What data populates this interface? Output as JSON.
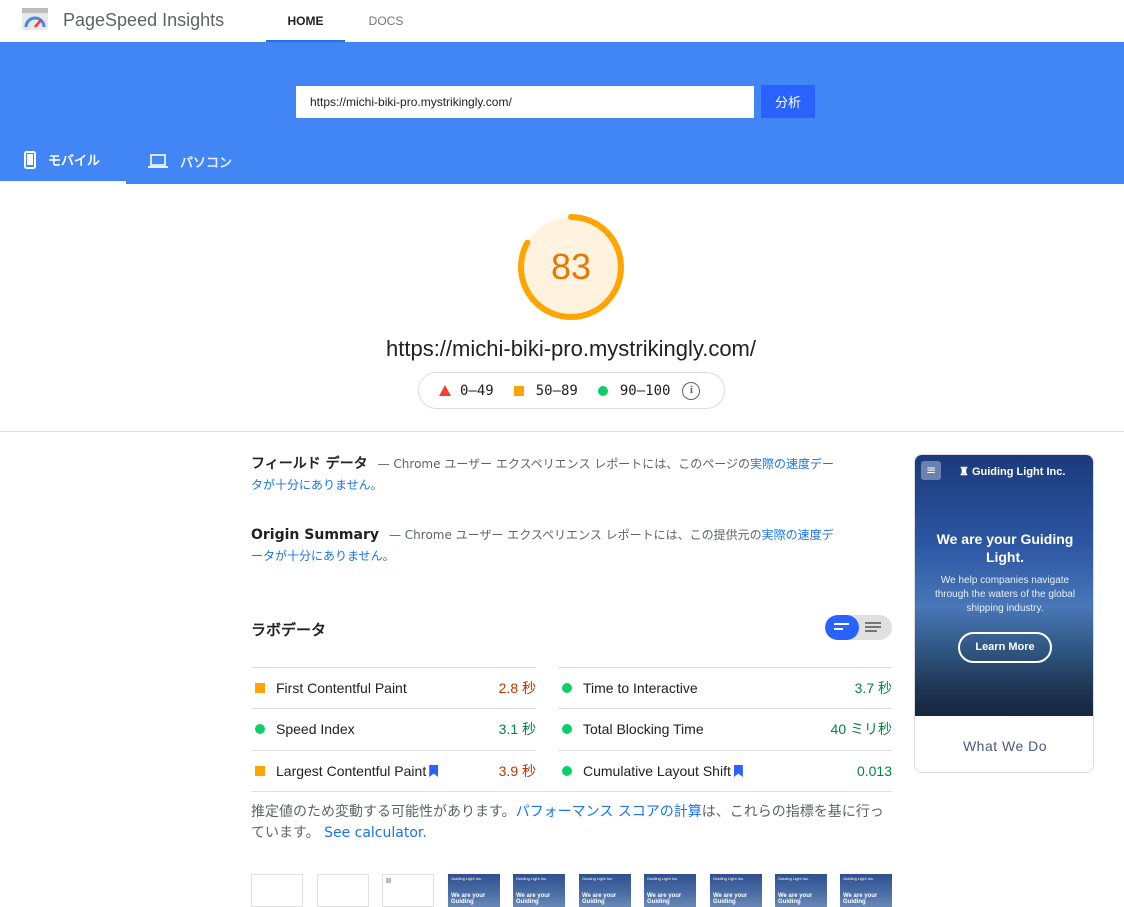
{
  "header": {
    "app_title": "PageSpeed Insights",
    "nav": [
      {
        "label": "HOME",
        "active": true
      },
      {
        "label": "DOCS",
        "active": false
      }
    ]
  },
  "search": {
    "url_value": "https://michi-biki-pro.mystrikingly.com/",
    "analyze_label": "分析"
  },
  "device_tabs": [
    {
      "label": "モバイル",
      "icon": "smartphone-icon",
      "active": true
    },
    {
      "label": "パソコン",
      "icon": "laptop-icon",
      "active": false
    }
  ],
  "score": {
    "value": "83",
    "fraction": 0.83,
    "color": "#ffa400",
    "url": "https://michi-biki-pro.mystrikingly.com/"
  },
  "legend": {
    "fail": "0–49",
    "average": "50–89",
    "pass": "90–100"
  },
  "field_data": {
    "title": "フィールド データ",
    "dash": "—",
    "text": "Chrome ユーザー エクスペリエンス レポートには、このページの",
    "link": "実際の速度データが十分にありません。"
  },
  "origin_summary": {
    "title": "Origin Summary",
    "dash": "—",
    "text": "Chrome ユーザー エクスペリエンス レポートには、この提供元の",
    "link": "実際の速度データが十分にありません。"
  },
  "lab_data": {
    "title": "ラボデータ",
    "metrics_left": [
      {
        "name": "First Contentful Paint",
        "value": "2.8 秒",
        "status": "average",
        "flag": false
      },
      {
        "name": "Speed Index",
        "value": "3.1 秒",
        "status": "pass",
        "flag": false
      },
      {
        "name": "Largest Contentful Paint",
        "value": "3.9 秒",
        "status": "average",
        "flag": true
      }
    ],
    "metrics_right": [
      {
        "name": "Time to Interactive",
        "value": "3.7 秒",
        "status": "pass",
        "flag": false
      },
      {
        "name": "Total Blocking Time",
        "value": "40 ミリ秒",
        "status": "pass",
        "flag": false
      },
      {
        "name": "Cumulative Layout Shift",
        "value": "0.013",
        "status": "pass",
        "flag": true
      }
    ]
  },
  "note": {
    "prefix": "推定値のため変動する可能性があります。",
    "link1": "パフォーマンス スコアの計算",
    "middle": "は、これらの指標を基に行っています。",
    "link2": "See calculator."
  },
  "filmstrip": {
    "brand_small": "Guiding Light Inc.",
    "hero_small": "We are your Guiding"
  },
  "screenshot": {
    "brand": "Guiding Light Inc.",
    "headline": "We are your Guiding Light.",
    "sub": "We help companies navigate through the waters of the global shipping industry.",
    "button": "Learn More",
    "footer": "What We Do"
  }
}
